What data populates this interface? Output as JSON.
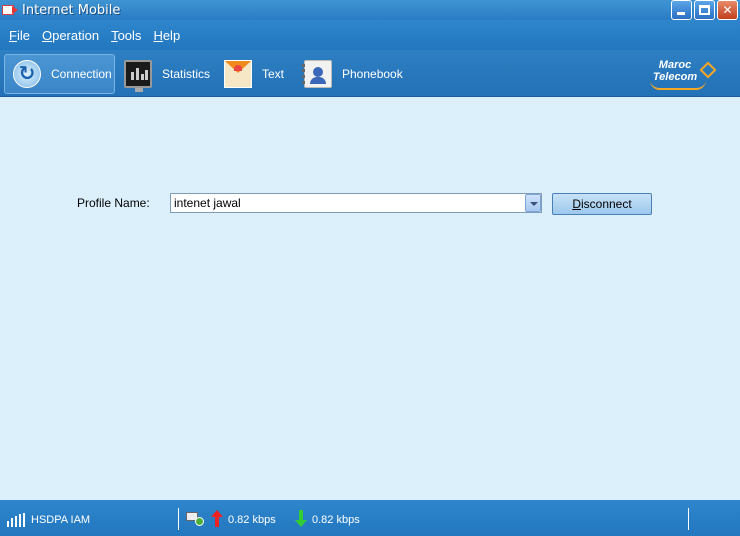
{
  "window": {
    "title": "Internet Mobile"
  },
  "menu": {
    "items": [
      {
        "accel": "F",
        "rest": "ile"
      },
      {
        "accel": "O",
        "rest": "peration"
      },
      {
        "accel": "T",
        "rest": "ools"
      },
      {
        "accel": "H",
        "rest": "elp"
      }
    ]
  },
  "toolbar": {
    "connection": "Connection",
    "statistics": "Statistics",
    "text": "Text",
    "phonebook": "Phonebook"
  },
  "logo": {
    "line1": "Maroc",
    "line2": "Telecom"
  },
  "connection": {
    "profile_label": "Profile Name:",
    "profile_value": "intenet jawal",
    "disconnect_accel": "D",
    "disconnect_rest": "isconnect"
  },
  "status": {
    "network": "HSDPA IAM",
    "upload": "0.82 kbps",
    "download": "0.82 kbps"
  },
  "colors": {
    "title_bar": "#2a7cc4",
    "background": "#dcf0fb",
    "upload_arrow": "#e22222",
    "download_arrow": "#33cc33"
  }
}
